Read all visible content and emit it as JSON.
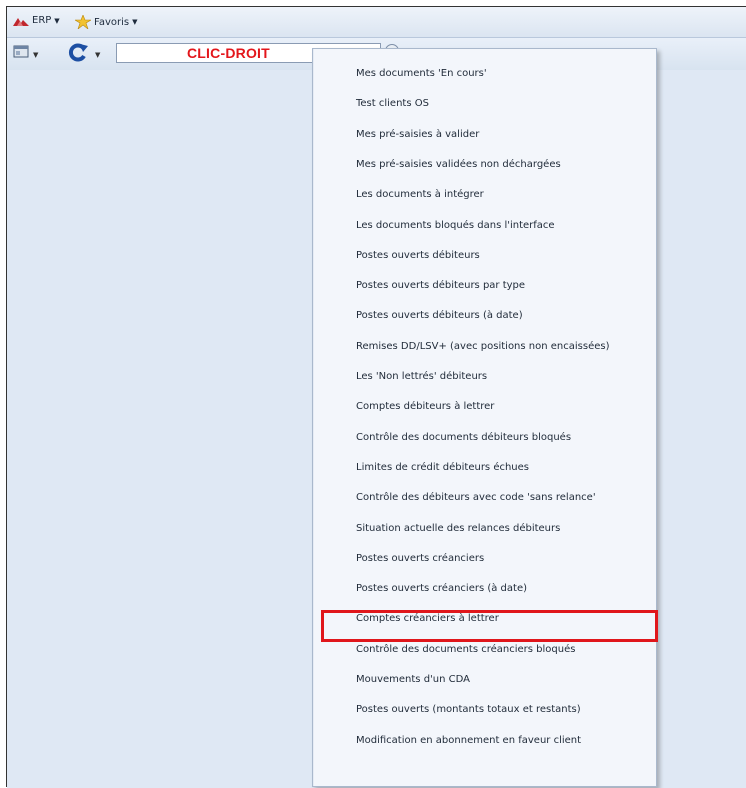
{
  "menubar": {
    "erp_label": "ERP",
    "favoris_label": "Favoris"
  },
  "toolbar": {
    "search_value": "CLIC-DROIT"
  },
  "dropdown": {
    "items": [
      "Mes documents 'En cours'",
      "Test clients OS",
      "Mes pré-saisies à valider",
      "Mes pré-saisies validées non déchargées",
      "Les documents à intégrer",
      "Les documents bloqués dans l'interface",
      "Postes ouverts débiteurs",
      "Postes ouverts débiteurs par type",
      "Postes ouverts débiteurs (à date)",
      "Remises DD/LSV+ (avec positions non encaissées)",
      "Les 'Non lettrés' débiteurs",
      "Comptes débiteurs à lettrer",
      "Contrôle des documents débiteurs bloqués",
      "Limites de crédit débiteurs échues",
      "Contrôle des débiteurs avec code 'sans relance'",
      "Situation actuelle des relances débiteurs",
      "Postes ouverts créanciers",
      "Postes ouverts créanciers (à date)",
      "Comptes créanciers à lettrer",
      "Contrôle des documents créanciers bloqués",
      "Mouvements d'un CDA",
      "Postes ouverts (montants totaux et restants)",
      "Modification en abonnement en faveur client"
    ],
    "highlighted_index": 17
  },
  "colors": {
    "highlight": "#e0161b",
    "annotation_text": "#e3161b",
    "workspace": "#dfe8f4"
  }
}
